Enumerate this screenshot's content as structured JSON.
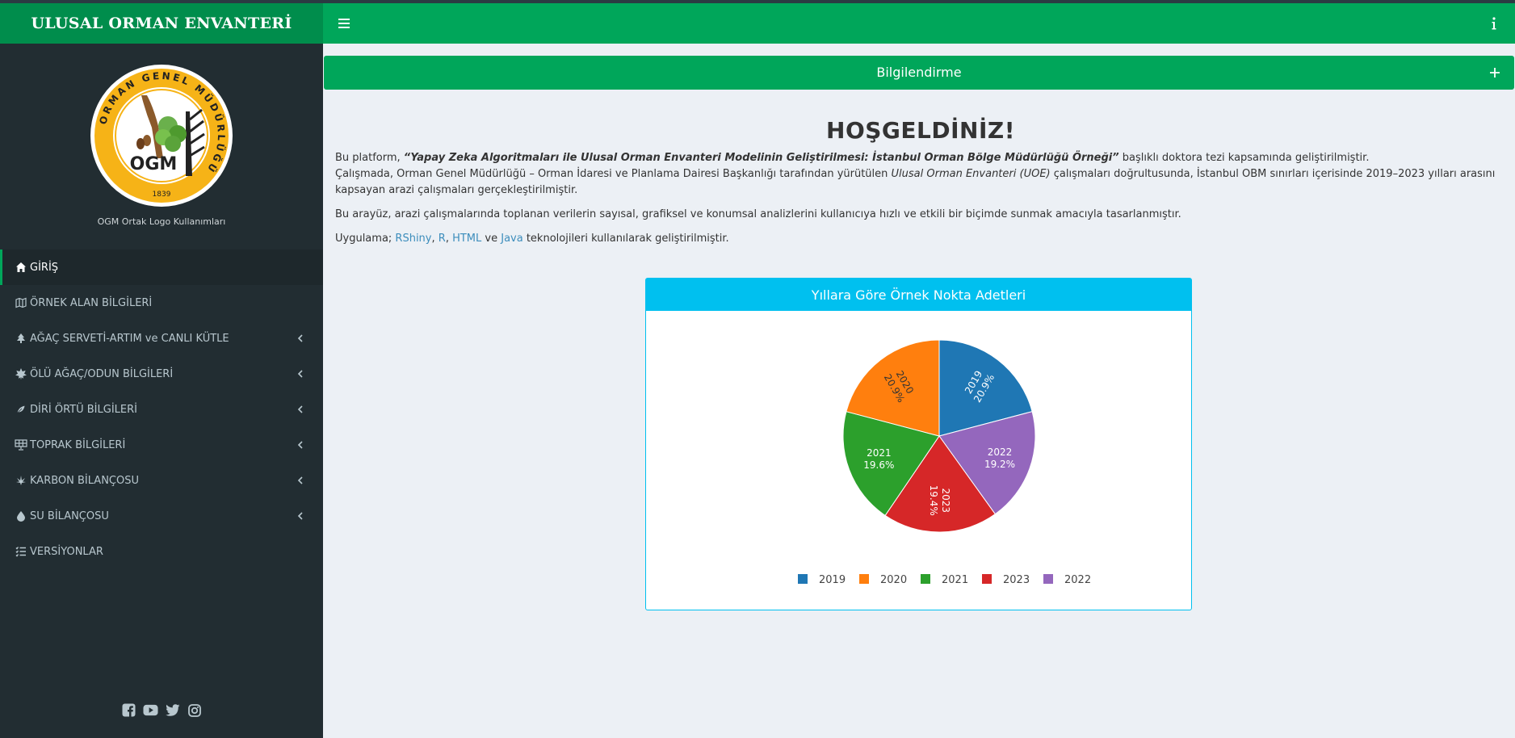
{
  "sidebar": {
    "title": "ULUSAL ORMAN ENVANTERİ",
    "logo": {
      "ring_text": "ORMAN GENEL MÜDÜRLÜĞÜ",
      "center_text": "OGM",
      "year": "1839",
      "caption": "OGM Ortak Logo Kullanımları"
    },
    "menu": [
      {
        "label": "GİRİŞ",
        "icon": "home-icon",
        "active": true,
        "submenu": false
      },
      {
        "label": "ÖRNEK ALAN BİLGİLERİ",
        "icon": "map-icon",
        "active": false,
        "submenu": false
      },
      {
        "label": "AĞAÇ SERVETİ-ARTIM ve CANLI KÜTLE",
        "icon": "tree-icon",
        "active": false,
        "submenu": true
      },
      {
        "label": "ÖLÜ AĞAÇ/ODUN BİLGİLERİ",
        "icon": "leaf-icon",
        "active": false,
        "submenu": true
      },
      {
        "label": "DİRİ ÖRTÜ BİLGİLERİ",
        "icon": "feather-icon",
        "active": false,
        "submenu": true
      },
      {
        "label": "TOPRAK BİLGİLERİ",
        "icon": "solar-panel-icon",
        "active": false,
        "submenu": true
      },
      {
        "label": "KARBON BİLANÇOSU",
        "icon": "cannabis-leaf-icon",
        "active": false,
        "submenu": true
      },
      {
        "label": "SU BİLANÇOSU",
        "icon": "droplet-icon",
        "active": false,
        "submenu": true
      },
      {
        "label": "VERSİYONLAR",
        "icon": "list-check-icon",
        "active": false,
        "submenu": false
      }
    ],
    "social": [
      "facebook-icon",
      "youtube-icon",
      "twitter-icon",
      "instagram-icon"
    ]
  },
  "header": {
    "menu_icon": "hamburger-icon",
    "info_icon": "info-icon"
  },
  "info_box": {
    "title": "Bilgilendirme",
    "toggle": "+"
  },
  "main": {
    "welcome": "HOŞGELDİNİZ!",
    "p1_prefix": "Bu platform, ",
    "p1_title": "“Yapay Zeka Algoritmaları ile Ulusal Orman Envanteri Modelinin Geliştirilmesi: İstanbul Orman Bölge Müdürlüğü Örneği”",
    "p1_suffix": " başlıklı doktora tezi kapsamında geliştirilmiştir.",
    "p2_prefix": "Çalışmada, Orman Genel Müdürlüğü – Orman İdaresi ve Planlama Dairesi Başkanlığı tarafından yürütülen ",
    "p2_em": "Ulusal Orman Envanteri (UOE)",
    "p2_suffix": " çalışmaları doğrultusunda, İstanbul OBM sınırları içerisinde 2019–2023 yılları arasını kapsayan arazi çalışmaları gerçekleştirilmiştir.",
    "p3": "Bu arayüz, arazi çalışmalarında toplanan verilerin sayısal, grafiksel ve konumsal analizlerini kullanıcıya hızlı ve etkili bir biçimde sunmak amacıyla tasarlanmıştır.",
    "p4_prefix": "Uygulama; ",
    "p4_link1": "RShiny",
    "p4_sep1": ", ",
    "p4_link2": "R",
    "p4_sep2": ", ",
    "p4_link3": "HTML",
    "p4_sep3": " ve ",
    "p4_link4": "Java",
    "p4_suffix": " teknolojileri kullanılarak geliştirilmiştir."
  },
  "chart_box": {
    "title": "Yıllara Göre Örnek Nokta Adetleri"
  },
  "chart_data": {
    "type": "pie",
    "title": "Yıllara Göre Örnek Nokta Adetleri",
    "categories": [
      "2019",
      "2022",
      "2023",
      "2021",
      "2020"
    ],
    "values": [
      20.9,
      19.2,
      19.4,
      19.6,
      20.9
    ],
    "labels": [
      "20.9%",
      "19.2%",
      "19.4%",
      "19.6%",
      "20.9%"
    ],
    "colors": [
      "#1f77b4",
      "#9467bd",
      "#d62728",
      "#2ca02c",
      "#ff7f0e"
    ],
    "legend": {
      "placement": "bottom",
      "order": [
        "2019",
        "2020",
        "2021",
        "2023",
        "2022"
      ]
    }
  },
  "colors": {
    "sidebar_bg": "#222d32",
    "brand_bg": "#008d4c",
    "header_bg": "#00a65a",
    "chart_header_bg": "#00c0ef",
    "link": "#3c8dbc"
  }
}
